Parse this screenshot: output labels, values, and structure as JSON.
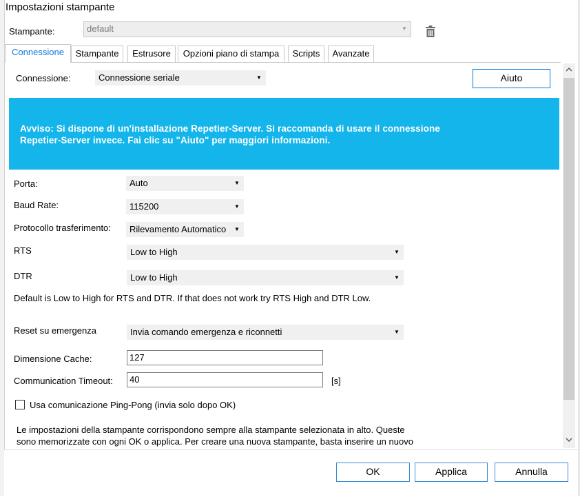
{
  "window": {
    "title": "Impostazioni stampante"
  },
  "printer": {
    "label": "Stampante:",
    "value": "default"
  },
  "tabs": [
    {
      "label": "Connessione",
      "active": true
    },
    {
      "label": "Stampante"
    },
    {
      "label": "Estrusore"
    },
    {
      "label": "Opzioni piano di stampa"
    },
    {
      "label": "Scripts"
    },
    {
      "label": "Avanzate"
    }
  ],
  "connection": {
    "label": "Connessione:",
    "value": "Connessione seriale",
    "help_button": "Aiuto"
  },
  "banner": {
    "text_line1": "Avviso: Si dispone di un'installazione Repetier-Server. Si raccomanda di usare il connessione",
    "text_line2": "Repetier-Server invece. Fai clic su \"Aiuto\" per maggiori informazioni.",
    "color": "#13b5ea"
  },
  "form": {
    "port": {
      "label": "Porta:",
      "value": "Auto"
    },
    "baud": {
      "label": "Baud Rate:",
      "value": "115200"
    },
    "protocol": {
      "label": "Protocollo trasferimento:",
      "value": "Rilevamento Automatico"
    },
    "rts": {
      "label": "RTS",
      "value": "Low to High"
    },
    "dtr": {
      "label": "DTR",
      "value": "Low to High"
    },
    "rts_dtr_note": "Default is Low to High for RTS and DTR. If that does not work try RTS High and DTR Low.",
    "emergency_reset": {
      "label": "Reset su emergenza",
      "value": "Invia comando emergenza e riconnetti"
    },
    "cache_size": {
      "label": "Dimensione Cache:",
      "value": "127"
    },
    "timeout": {
      "label": "Communication Timeout:",
      "value": "40",
      "unit": "[s]"
    },
    "ping_pong": {
      "label": "Usa comunicazione Ping-Pong (invia solo dopo OK)",
      "checked": false
    },
    "info_line1": "Le impostazioni della stampante corrispondono sempre alla stampante selezionata in alto. Queste",
    "info_line2": "sono memorizzate con ogni OK o applica. Per creare una nuova stampante, basta inserire un nuovo"
  },
  "buttons": {
    "ok": "OK",
    "apply": "Applica",
    "cancel": "Annulla"
  },
  "icons": {
    "trash": "trash-icon",
    "dropdown": "chevron-down-icon"
  }
}
